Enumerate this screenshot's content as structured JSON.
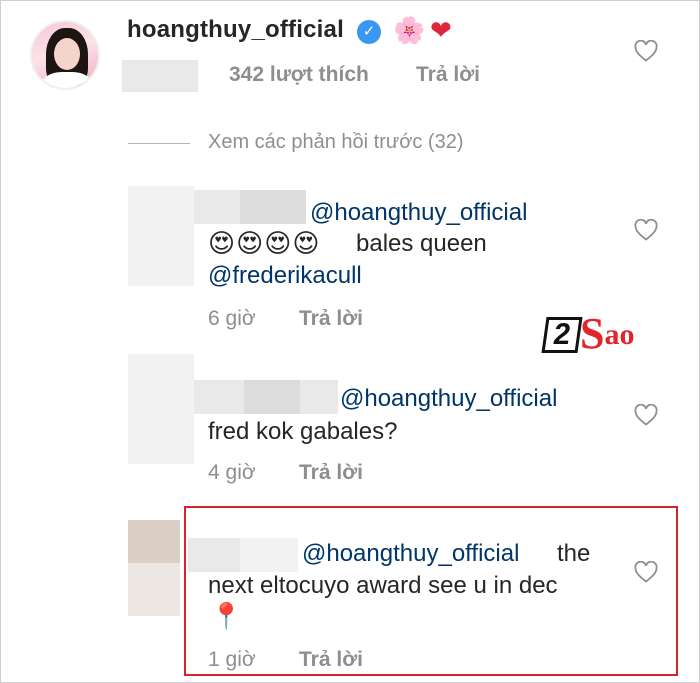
{
  "post": {
    "username": "hoangthuy_official",
    "verified_icon": "verified-badge-icon",
    "emoji_1": "🌸",
    "emoji_2": "❤",
    "likes": "342 lượt thích",
    "reply": "Trả lời"
  },
  "view_previous": "Xem các phản hồi trước (32)",
  "comments": [
    {
      "mention": "@hoangthuy_official",
      "emojis": "😍😍😍😍",
      "text": "bales queen",
      "mention_2": "@frederikacull",
      "time": "6 giờ",
      "reply": "Trả lời"
    },
    {
      "mention": "@hoangthuy_official",
      "text": "fred kok gabales?",
      "time": "4 giờ",
      "reply": "Trả lời"
    },
    {
      "mention": "@hoangthuy_official",
      "text_1": "the",
      "text_2": "next eltocuyo award see u in dec",
      "pin": "📍",
      "time": "1 giờ",
      "reply": "Trả lời"
    }
  ],
  "watermark": {
    "digit": "2",
    "s": "S",
    "rest": "ao"
  },
  "colors": {
    "mention": "#003569",
    "muted": "#8e8e8e",
    "highlight_box": "#d8232a",
    "verified": "#3897f0"
  }
}
